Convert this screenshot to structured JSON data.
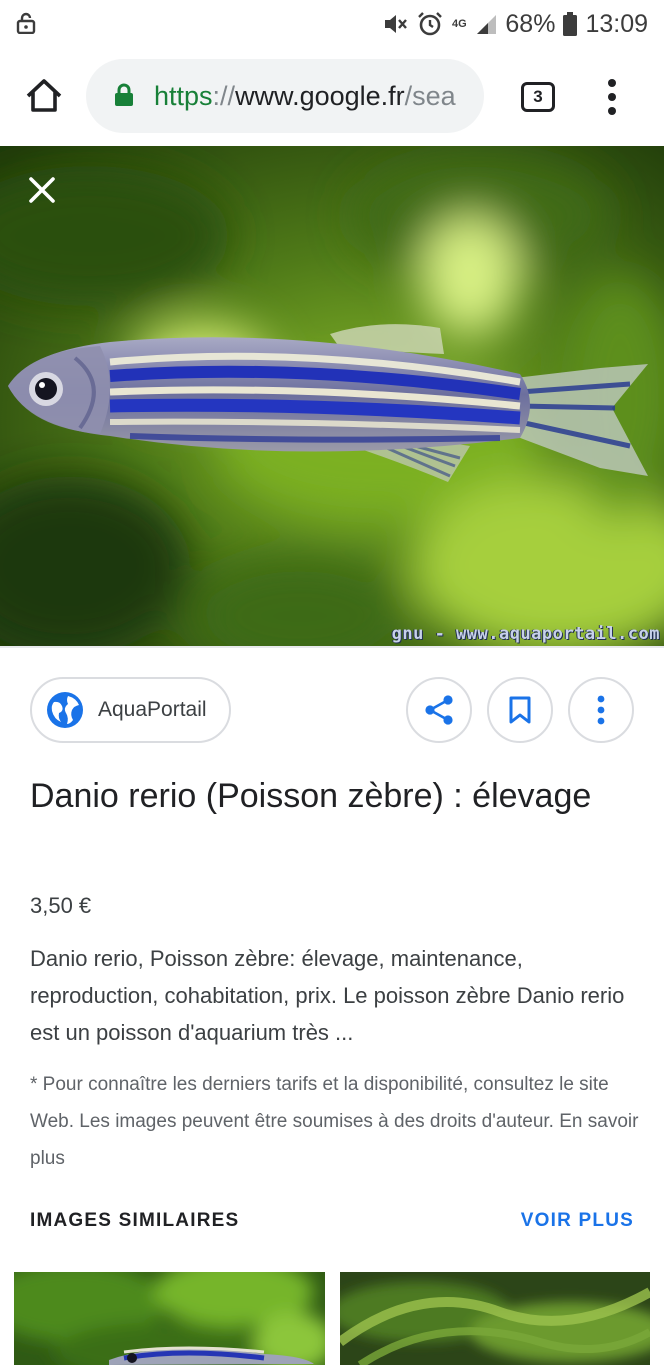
{
  "status_bar": {
    "battery": "68%",
    "time": "13:09",
    "network": "4G"
  },
  "browser": {
    "url_scheme": "https",
    "url_separator": "://",
    "url_host": "www.google.fr",
    "url_path": "/sea",
    "tab_count": "3"
  },
  "image": {
    "watermark": "gnu - www.aquaportail.com"
  },
  "source": {
    "name": "AquaPortail"
  },
  "result": {
    "title": "Danio rerio (Poisson zèbre) : élevage",
    "price": "3,50 €",
    "description": "Danio rerio, Poisson zèbre: élevage, maintenance, reproduction, cohabitation, prix. Le poisson zèbre Danio rerio est un poisson d'aquarium très ...",
    "notice": "* Pour connaître les derniers tarifs et la disponibilité, consultez le site Web. Les images peuvent être soumises à des droits d'auteur. En savoir plus"
  },
  "similar": {
    "heading": "IMAGES SIMILAIRES",
    "more_label": "VOIR PLUS"
  },
  "colors": {
    "link_blue": "#1a73e8",
    "secure_green": "#188038"
  }
}
